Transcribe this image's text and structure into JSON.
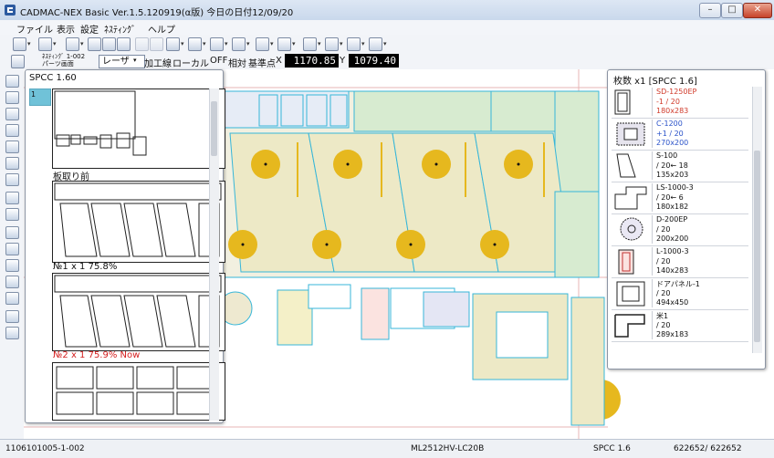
{
  "window": {
    "title": "CADMAC-NEX Basic Ver.1.5.120919(α版) 今日の日付12/09/20"
  },
  "menu": [
    {
      "label": "ファイル"
    },
    {
      "label": "表示"
    },
    {
      "label": "設定"
    },
    {
      "label": "ﾈｽﾃｨﾝｸﾞ"
    },
    {
      "label": "ヘルプ"
    }
  ],
  "toolbar2": {
    "small_label_1": "ﾈｽﾃｨﾝｸﾞ 1-002",
    "small_label_2": "パーツ画面",
    "process_combo": "レーザ",
    "btn_machining": "加工線",
    "btn_local": "ローカル",
    "local_state": "OFF",
    "btn_relative": "相対",
    "btn_base": "基準点",
    "x_label": "X",
    "x_value": "1170.85",
    "y_label": "Y",
    "y_value": "1079.40"
  },
  "left_panel": {
    "title": "SPCC 1.60",
    "tab_number": "1",
    "sheet_caption_0": "板取り前",
    "sheets": [
      {
        "caption": "№1 x 1   75.8%",
        "color": "#111111"
      },
      {
        "caption": "№2 x 1   75.9% Now",
        "color": "#d42020"
      }
    ]
  },
  "right_panel": {
    "title": "枚数 x1 [SPCC 1.6]",
    "parts": [
      {
        "name": "SD-1250EP",
        "count": "-1  /  20",
        "size": "180x283",
        "color": "#d03a2a"
      },
      {
        "name": "C-1200",
        "count": "+1  /  20",
        "size": "270x200",
        "color": "#2a52c9"
      },
      {
        "name": "S-100",
        "count": "/  20←  18",
        "size": "135x203",
        "color": "#111111"
      },
      {
        "name": "LS-1000-3",
        "count": "/  20←  6",
        "size": "180x182",
        "color": "#111111"
      },
      {
        "name": "D-200EP",
        "count": "/  20",
        "size": "200x200",
        "color": "#111111"
      },
      {
        "name": "L-1000-3",
        "count": "/  20",
        "size": "140x283",
        "color": "#111111"
      },
      {
        "name": "ドアパネル-1",
        "count": "/  20",
        "size": "494x450",
        "color": "#111111"
      },
      {
        "name": "米1",
        "count": "/  20",
        "size": "289x183",
        "color": "#111111"
      }
    ]
  },
  "status": {
    "left": "1106101005-1-002",
    "machine": "ML2512HV-LC20B",
    "material": "SPCC 1.6",
    "count": "622652/ 622652"
  },
  "colors": {
    "accent": "#70c2d8",
    "part_fill_green": "#d7ebd0",
    "part_fill_yellow": "#f4efc6",
    "hole_dot": "#e6b81e",
    "edge_cyan": "#37b6d8"
  }
}
